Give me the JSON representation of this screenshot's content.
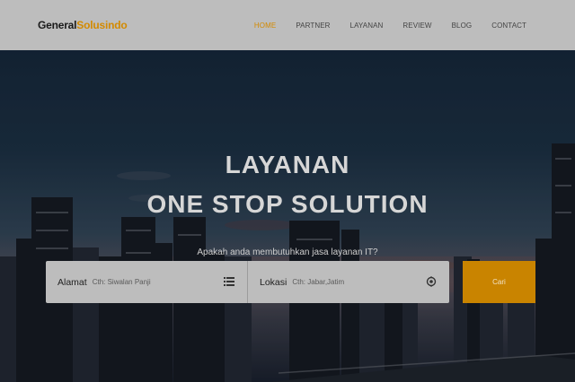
{
  "brand": {
    "part1": "General",
    "part2": "Solusindo"
  },
  "nav": {
    "items": [
      {
        "label": "HOME",
        "active": true
      },
      {
        "label": "PARTNER",
        "active": false
      },
      {
        "label": "LAYANAN",
        "active": false
      },
      {
        "label": "REVIEW",
        "active": false
      },
      {
        "label": "BLOG",
        "active": false
      },
      {
        "label": "CONTACT",
        "active": false
      }
    ]
  },
  "hero": {
    "title_line1": "LAYANAN",
    "title_line2": "ONE STOP SOLUTION",
    "subtitle": "Apakah anda membutuhkan jasa layanan IT?"
  },
  "search": {
    "address_label": "Alamat",
    "address_placeholder": "Cth: Siwalan Panji",
    "address_icon": "list-icon",
    "location_label": "Lokasi",
    "location_placeholder": "Cth: Jabar,Jatim",
    "location_icon": "location-pin-icon",
    "button_label": "Cari"
  },
  "colors": {
    "accent": "#d38a00",
    "navbar_bg": "#bdbdbd",
    "button_bg": "#c98400"
  }
}
